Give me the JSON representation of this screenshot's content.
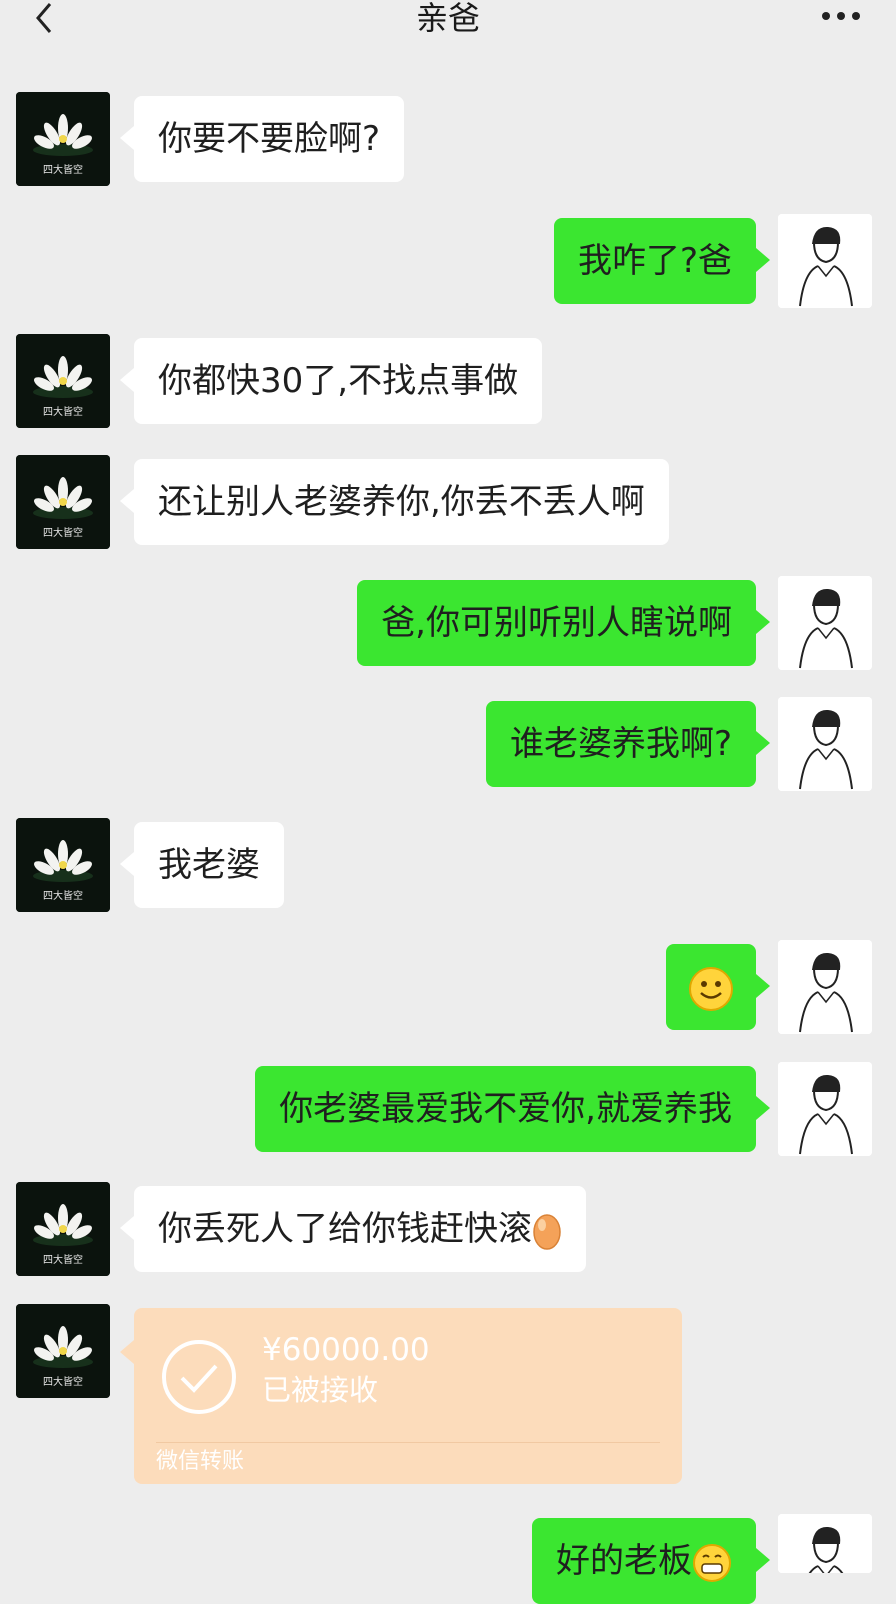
{
  "header": {
    "title": "亲爸",
    "back_icon": "chevron-left-icon",
    "more_icon": "ellipsis-icon"
  },
  "contact": {
    "avatar_caption": "四大皆空"
  },
  "messages": [
    {
      "side": "left",
      "text": "你要不要脸啊?"
    },
    {
      "side": "right",
      "text": "我咋了?爸"
    },
    {
      "side": "left",
      "text": "你都快30了,不找点事做"
    },
    {
      "side": "left",
      "text": "还让别人老婆养你,你丢不丢人啊"
    },
    {
      "side": "right",
      "text": "爸,你可别听别人瞎说啊"
    },
    {
      "side": "right",
      "text": "谁老婆养我啊?"
    },
    {
      "side": "left",
      "text": "我老婆"
    },
    {
      "side": "right",
      "text": "",
      "emoji": "smile-emoji"
    },
    {
      "side": "right",
      "text": "你老婆最爱我不爱你,就爱养我"
    },
    {
      "side": "left",
      "text": "你丢死人了给你钱赶快滚",
      "emoji": "egg-emoji"
    },
    {
      "side": "left",
      "type": "transfer",
      "amount": "¥60000.00",
      "status": "已被接收",
      "label": "微信转账"
    },
    {
      "side": "right",
      "text": "好的老板",
      "emoji": "grin-emoji"
    }
  ],
  "colors": {
    "background": "#ededed",
    "sent_bubble": "#3be630",
    "received_bubble": "#ffffff",
    "transfer_card": "#fcdcbb"
  }
}
